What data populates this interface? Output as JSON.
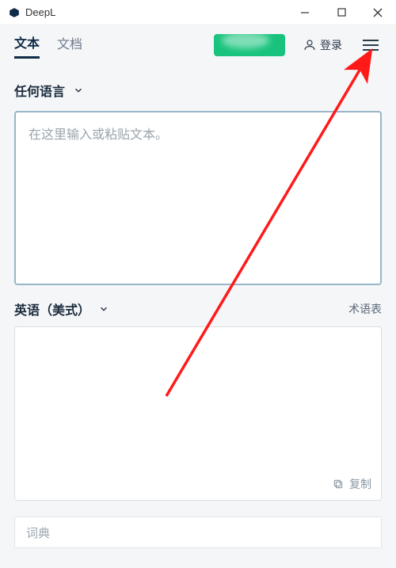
{
  "window": {
    "title": "DeepL"
  },
  "tabs": {
    "text": "文本",
    "document": "文档"
  },
  "login": {
    "label": "登录"
  },
  "source": {
    "language": "任何语言",
    "placeholder": "在这里输入或粘贴文本。"
  },
  "target": {
    "language": "英语（美式）",
    "glossary": "术语表",
    "copy": "复制"
  },
  "dictionary": {
    "label": "词典"
  }
}
